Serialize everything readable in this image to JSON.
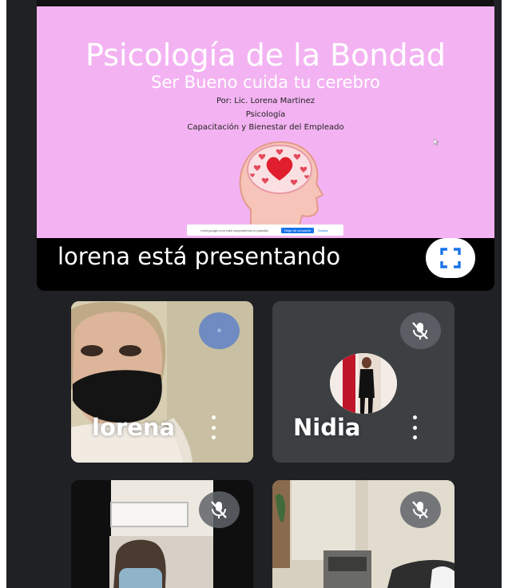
{
  "presentation": {
    "slide": {
      "title": "Psicología de la Bondad",
      "subtitle": "Ser Bueno cuida tu cerebro",
      "author": "Por: Lic. Lorena Martinez",
      "field": "Psicología",
      "course": "Capacitación y Bienestar del Empleado",
      "share_bar": {
        "text": "meet.google.com está compartiendo tu pantalla.",
        "stop_label": "Dejar de compartir",
        "hide_label": "Ocultar"
      }
    },
    "presenting_label": "lorena está presentando",
    "fullscreen_icon": "fullscreen-icon"
  },
  "participants": [
    {
      "name": "lorena",
      "speaking": true,
      "muted": false
    },
    {
      "name": "Nidia",
      "speaking": false,
      "muted": true
    },
    {
      "name": "",
      "muted": true
    },
    {
      "name": "",
      "muted": true
    }
  ],
  "colors": {
    "background": "#202124",
    "slide_pink": "#f3b3f2",
    "speaking_indicator": "#6f8bc2",
    "tile": "#3c4043"
  }
}
